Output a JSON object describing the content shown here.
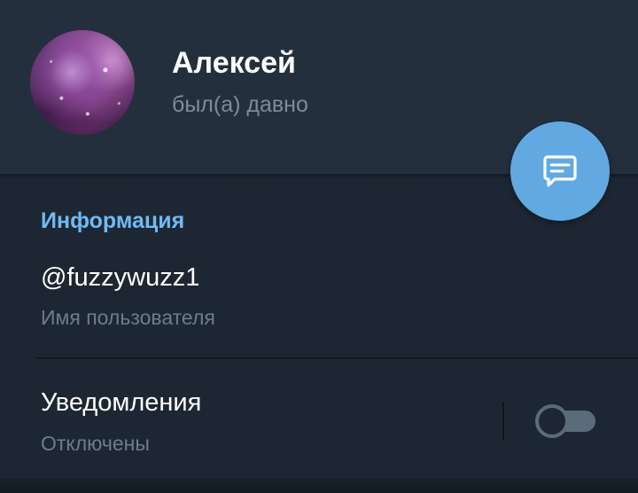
{
  "profile": {
    "name": "Алексей",
    "status": "был(а) давно",
    "avatar_icon": "avatar-photo"
  },
  "fab": {
    "icon": "message-icon",
    "color": "#62a9e2"
  },
  "info": {
    "section_title": "Информация",
    "username": "@fuzzywuzz1",
    "username_caption": "Имя пользователя"
  },
  "notifications": {
    "title": "Уведомления",
    "caption": "Отключены",
    "enabled": false
  },
  "colors": {
    "background": "#1d2733",
    "header": "#242f3d",
    "accent": "#71baf2",
    "secondary_text": "#6f7c89"
  }
}
